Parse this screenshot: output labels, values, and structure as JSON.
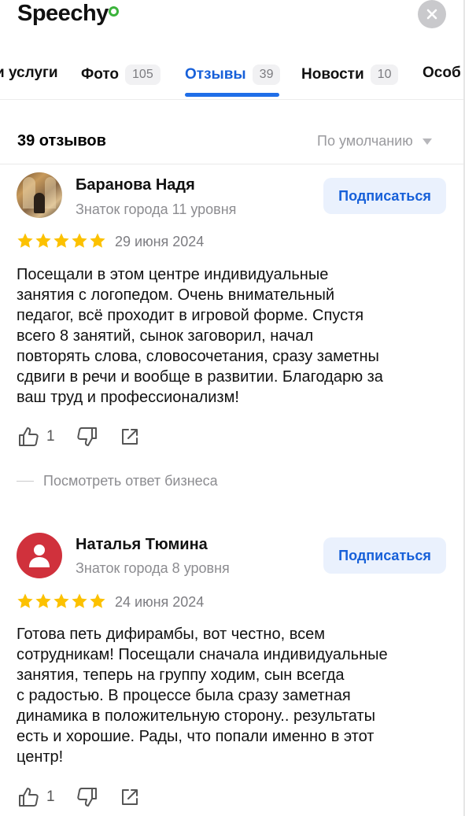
{
  "header": {
    "logo_text": "Speechy",
    "close_icon": "close-icon"
  },
  "tabs": [
    {
      "label": "и услуги",
      "count": ""
    },
    {
      "label": "Фото",
      "count": "105"
    },
    {
      "label": "Отзывы",
      "count": "39",
      "active": true
    },
    {
      "label": "Новости",
      "count": "10"
    },
    {
      "label": "Особ",
      "count": ""
    }
  ],
  "reviews_header": {
    "count_label": "39 отзывов",
    "sort_label": "По умолчанию"
  },
  "reviews": [
    {
      "author": "Баранова Надя",
      "level": "Знаток города 11 уровня",
      "subscribe": "Подписаться",
      "rating": 5,
      "date": "29 июня 2024",
      "text_lines": [
        "Посещали в этом центре индивидуальные",
        "занятия с логопедом. Очень внимательный",
        "педагог, всё проходит в игровой форме. Спустя",
        "всего 8 занятий, сынок заговорил, начал",
        "повторять слова, словосочетания, сразу заметны",
        "сдвиги в речи и вообще в развитии. Благодарю за",
        "ваш труд и профессионализм!"
      ],
      "likes": "1",
      "business_reply": "Посмотреть ответ бизнеса"
    },
    {
      "author": "Наталья Тюмина",
      "level": "Знаток города 8 уровня",
      "subscribe": "Подписаться",
      "rating": 5,
      "date": "24 июня 2024",
      "text_lines": [
        "Готова петь дифирамбы, вот честно, всем",
        "сотрудникам! Посещали сначала индивидуальные",
        "занятия, теперь на группу ходим, сын всегда",
        "с радостью. В процессе была сразу заметная",
        "динамика в положительную сторону.. результаты",
        "есть и хорошие. Рады, что попали именно в этот",
        "центр!"
      ],
      "likes": "1"
    }
  ],
  "colors": {
    "accent": "#1760d9",
    "star": "#fcc100",
    "subscribe_bg": "#eaf1fd",
    "avatar_red": "#d0313c",
    "logo_green": "#3bb33b"
  }
}
